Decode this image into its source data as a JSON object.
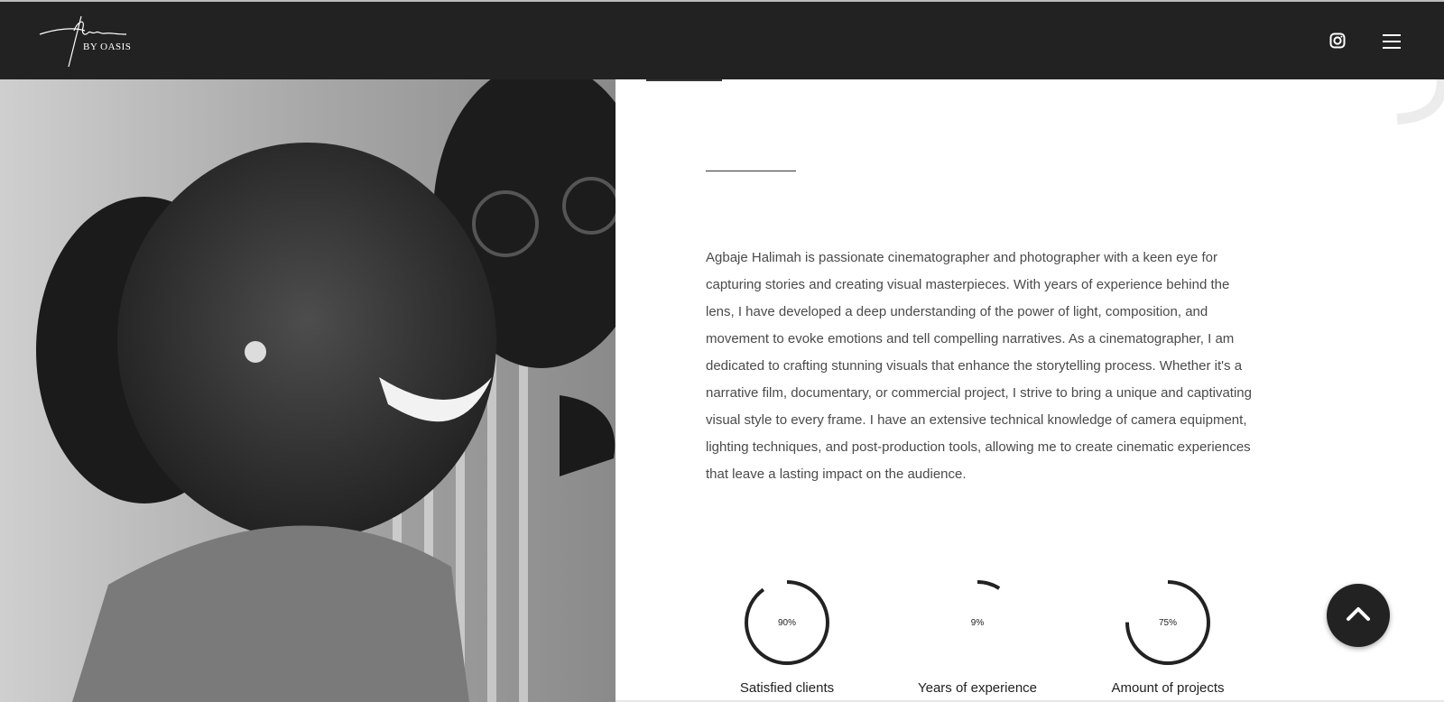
{
  "header": {
    "logo_sub": "BY OASIS",
    "icons": [
      "instagram-icon",
      "menu-icon"
    ]
  },
  "about": {
    "text": "Agbaje Halimah is passionate cinematographer and photographer with a keen eye for capturing stories and creating visual masterpieces. With years of experience behind the lens, I have developed a deep understanding of the power of light, composition, and movement to evoke emotions and tell compelling narratives. As a cinematographer, I am dedicated to crafting stunning visuals that enhance the storytelling process. Whether it's a narrative film, documentary, or commercial project, I strive to bring a unique and captivating visual style to every frame. I have an extensive technical knowledge of camera equipment, lighting techniques, and post-production tools, allowing me to create cinematic experiences that leave a lasting impact on the audience."
  },
  "stats": [
    {
      "value": "90%",
      "label": "Satisfied clients",
      "percent": 90
    },
    {
      "value": "9%",
      "label": "Years of experience",
      "percent": 9
    },
    {
      "value": "75%",
      "label": "Amount of projects",
      "percent": 75
    }
  ],
  "colors": {
    "header_bg": "#222222",
    "ring": "#222222",
    "text": "#4a4a4a"
  },
  "scroll_top": {
    "icon": "chevron-up-icon"
  }
}
